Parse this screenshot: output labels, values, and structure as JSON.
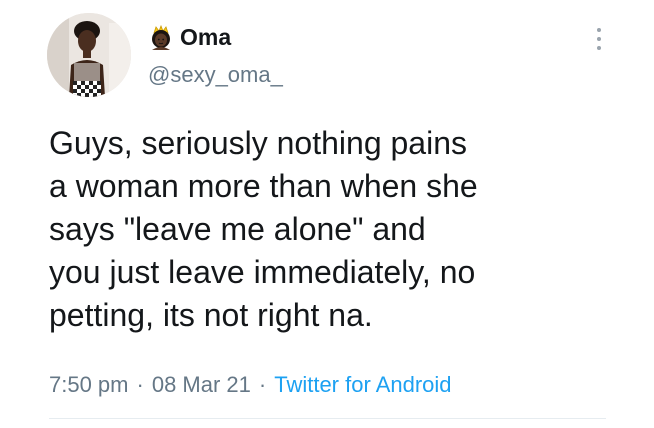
{
  "tweet": {
    "display_name": "Oma",
    "name_emoji": "princess-emoji",
    "handle": "@sexy_oma_",
    "text_lines": [
      "Guys, seriously nothing pains",
      "a woman more than when she",
      "says \"leave me alone\" and",
      "you just leave immediately, no",
      "petting, its not right na."
    ],
    "time": "7:50 pm",
    "separator": "·",
    "date": "08 Mar 21",
    "source": "Twitter for Android",
    "more_icon": "more-vertical-icon",
    "colors": {
      "text": "#14171a",
      "secondary": "#657786",
      "link": "#1da1f2"
    }
  }
}
